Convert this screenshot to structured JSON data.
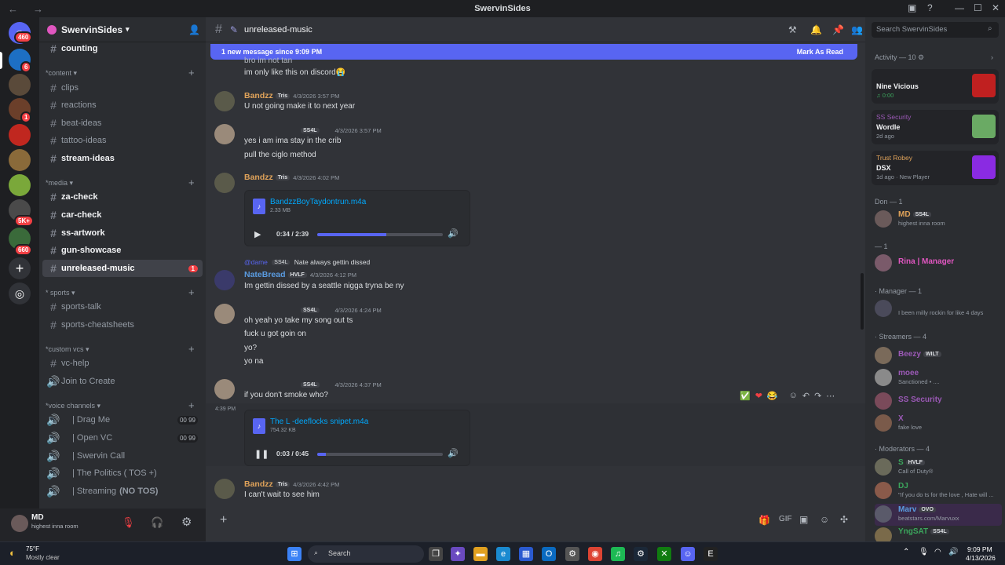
{
  "window": {
    "title": "SwervinSides",
    "back": "←",
    "forward": "→"
  },
  "servers": {
    "badges": [
      "460",
      "6",
      "1",
      "5K+",
      "660"
    ]
  },
  "sidebar": {
    "server_name": "SwervinSides",
    "channels_top": [
      {
        "name": "counting",
        "bold": true
      }
    ],
    "categories": [
      {
        "label": "*content",
        "channels": [
          {
            "name": "clips",
            "bold": false
          },
          {
            "name": "reactions",
            "bold": false
          },
          {
            "name": "beat-ideas",
            "bold": false
          },
          {
            "name": "tattoo-ideas",
            "bold": false
          },
          {
            "name": "stream-ideas",
            "bold": true
          }
        ]
      },
      {
        "label": "*media",
        "channels": [
          {
            "name": "za-check",
            "bold": true
          },
          {
            "name": "car-check",
            "bold": true
          },
          {
            "name": "ss-artwork",
            "bold": true
          },
          {
            "name": "gun-showcase",
            "bold": true
          },
          {
            "name": "unreleased-music",
            "bold": true,
            "selected": true,
            "mentions": "1"
          }
        ]
      },
      {
        "label": "* sports",
        "channels": [
          {
            "name": "sports-talk"
          },
          {
            "name": "sports-cheatsheets"
          }
        ]
      },
      {
        "label": "*custom vcs",
        "channels": [
          {
            "name": "vc-help"
          },
          {
            "name": "Join to Create"
          }
        ]
      },
      {
        "label": "*voice channels",
        "channels": [
          {
            "name": "| Drag Me",
            "count": "00 99"
          },
          {
            "name": "| Open VC",
            "count": "00 99"
          },
          {
            "name": "| Swervin Call"
          },
          {
            "name": "| The Politics ( TOS +)"
          },
          {
            "name": "| Streaming",
            "suffix": "(NO TOS)"
          }
        ]
      }
    ]
  },
  "user_panel": {
    "name": "MD",
    "status": "highest inna room"
  },
  "channel_header": {
    "name": "unreleased-music"
  },
  "new_message_bar": {
    "text": "1 new message since 9:09 PM",
    "action": "Mark As Read"
  },
  "messages": [
    {
      "type": "text",
      "lines": [
        "bro im not tan",
        "im only like this on discord😭"
      ]
    },
    {
      "user": "Bandzz",
      "color": "#e0a35a",
      "tag": "Tris",
      "time": "4/3/2026 3:57 PM",
      "lines": [
        "U not going make it to next year"
      ]
    },
    {
      "user": "",
      "tag": "SS4L",
      "time": "4/3/2026 3:57 PM",
      "lines": [
        "yes i am ima stay in the crib",
        "pull the ciglo method"
      ]
    },
    {
      "user": "Bandzz",
      "color": "#e0a35a",
      "tag": "Tris",
      "time": "4/3/2026 4:02 PM",
      "attachment": {
        "file": "BandzzBoyTaydontrun.m4a",
        "size": "2.33 MB",
        "time": "0:34 / 2:39",
        "progress": 0.55
      }
    },
    {
      "reply": {
        "to": "@dame",
        "tag": "SS4L",
        "text": "Nate always gettin dissed"
      },
      "user": "NateBread",
      "color": "#5a9be0",
      "tag": "HVLF",
      "time": "4/3/2026 4:12 PM",
      "lines": [
        "Im gettin dissed by a seattle nigga tryna be ny"
      ]
    },
    {
      "user": "",
      "tag": "SS4L",
      "time": "4/3/2026 4:24 PM",
      "lines": [
        "oh yeah yo take my song out ts",
        "fuck u got goin on",
        "yo?",
        "yo na"
      ]
    },
    {
      "user": "",
      "tag": "SS4L",
      "time": "4/3/2026 4:37 PM",
      "lines": [
        "if you don't smoke who?"
      ]
    },
    {
      "side_time": "4:39 PM",
      "attachment": {
        "file": "The L -deeflocks snipet.m4a",
        "size": "754.32 KB",
        "time": "0:03 / 0:45",
        "progress": 0.07
      }
    },
    {
      "user": "Bandzz",
      "color": "#e0a35a",
      "tag": "Tris",
      "time": "4/3/2026 4:42 PM",
      "lines": [
        "I can't wait to see him"
      ]
    }
  ],
  "reactions_bar": [
    "✅",
    "❤",
    "😂"
  ],
  "members": {
    "search_placeholder": "Search SwervinSides",
    "activity_header": "Activity — 10",
    "activities": [
      {
        "head": "",
        "title": "Nine Vicious",
        "sub": "♫ 0:00",
        "color": "#c02020"
      },
      {
        "head": "SS Security",
        "title": "Wordle",
        "sub": "2d ago",
        "color": "#6aaa64"
      },
      {
        "head": "Trust Robey",
        "title": "DSX",
        "sub": "1d ago · New Player",
        "color": "#8a2be2"
      }
    ],
    "groups": [
      {
        "label": "Don — 1",
        "members": [
          {
            "name": "MD",
            "tag": "SS4L",
            "status": "highest inna room",
            "color": "#e0a35a"
          }
        ]
      },
      {
        "label": "— 1",
        "members": [
          {
            "name": "Rina | Manager",
            "status": "",
            "color": "#e056c0"
          }
        ]
      },
      {
        "label": "· Manager — 1",
        "members": [
          {
            "name": "",
            "status": "I been milly rockin for like 4 days",
            "color": "#5865f2"
          }
        ]
      },
      {
        "label": "· Streamers — 4",
        "members": [
          {
            "name": "Beezy",
            "tag": "WILT",
            "status": "",
            "color": "#9b59b6"
          },
          {
            "name": "moee",
            "status": "Sanctioned • ....",
            "color": "#9b59b6"
          },
          {
            "name": "SS Security",
            "status": "",
            "color": "#9b59b6"
          },
          {
            "name": "X",
            "status": "fake love",
            "color": "#9b59b6"
          }
        ]
      },
      {
        "label": "· Moderators — 4",
        "members": [
          {
            "name": "S",
            "tag": "HVLF",
            "status": "Call of Duty®",
            "color": "#3ba55c"
          },
          {
            "name": "DJ",
            "status": "\"If you do ts for the love , Hate will ...",
            "color": "#3ba55c"
          },
          {
            "name": "Marv",
            "tag": "OVO",
            "status": "beatstars.com/Marvuxx",
            "color": "#5a9be0"
          },
          {
            "name": "YngSAT",
            "tag": "SS4L",
            "status": "",
            "color": "#3ba55c"
          }
        ]
      }
    ]
  },
  "taskbar": {
    "weather_temp": "75°F",
    "weather_desc": "Mostly clear",
    "search": "Search",
    "time": "9:09 PM",
    "date": "4/13/2026"
  }
}
